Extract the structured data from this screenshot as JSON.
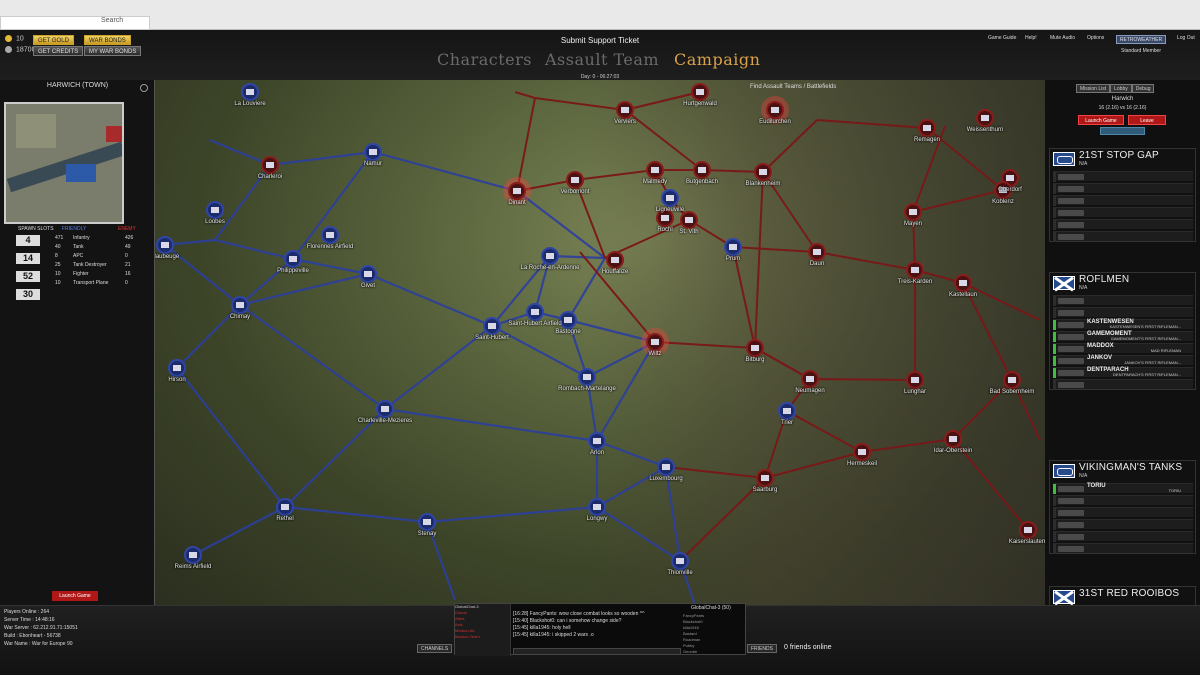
{
  "browser": {
    "search_label": "Search"
  },
  "top": {
    "gold": "10",
    "credits": "18700",
    "get_gold": "Get Gold",
    "war_bonds": "War Bonds",
    "get_credits": "Get Credits",
    "my_war_bonds": "My War Bonds",
    "support": "Submit Support Ticket",
    "tabs": [
      "Characters",
      "Assault Team",
      "Campaign"
    ],
    "day_time": "Day: 0 - 06:27:03",
    "links": [
      "Game Guide",
      "Help!",
      "Mute Audio",
      "Options",
      "Log Out"
    ],
    "rank": "RETROWEATHER",
    "member": "Standard Member"
  },
  "left": {
    "title": "HARWICH (TOWN)",
    "spawn_title": "SPAWN SLOTS",
    "friendly": "FRIENDLY",
    "enemy": "ENEMY",
    "spawn_values": [
      "4",
      "14",
      "52",
      "30"
    ],
    "units": [
      {
        "f": "471",
        "name": "Infantry",
        "e": "426"
      },
      {
        "f": "40",
        "name": "Tank",
        "e": "49"
      },
      {
        "f": "8",
        "name": "APC",
        "e": "0"
      },
      {
        "f": "25",
        "name": "Tank Destroyer",
        "e": "21"
      },
      {
        "f": "10",
        "name": "Fighter",
        "e": "16"
      },
      {
        "f": "10",
        "name": "Transport Plane",
        "e": "0"
      }
    ],
    "launch": "Launch Game"
  },
  "map": {
    "breadcrumb": "Find Assault Teams / Battlefields",
    "nodes": [
      "La Louviere",
      "Charleroi",
      "Namur",
      "Dinant",
      "Verbomont",
      "Malmedy",
      "Butgenbach",
      "Ligneuville",
      "Rochl",
      "St. Vith",
      "Blankenheim",
      "Eudilurchen",
      "Hurtgenwald",
      "Verviers",
      "Remagen",
      "Weissenthurn",
      "Oberdorf",
      "Koblenz",
      "Mayen",
      "Daun",
      "Prum",
      "Loobes",
      "Florennes Airfield",
      "Philippeville",
      "Givet",
      "Chimay",
      "La Roche-en-Ardenne",
      "Houffalize",
      "Saint-Hubert Airfield",
      "Bastogne",
      "Saint-Hubert",
      "Wiltz",
      "Bitburg",
      "Treis-Karden",
      "Kastellaun",
      "Neumagen",
      "Lunghar",
      "Bad Sobernheim",
      "Hirson",
      "Rombach-Martelange",
      "Charleville-Mezieres",
      "Arlon",
      "Trier",
      "Hermeskeil",
      "Idar-Oberstein",
      "Luxembourg",
      "Saarburg",
      "Rethel",
      "Longwy",
      "Stenay",
      "Thionville",
      "Reims Airfield",
      "Kaiserslautern",
      "Maubeuge"
    ]
  },
  "right": {
    "tabs": [
      "Mission List",
      "Lobby",
      "Debug"
    ],
    "map_name": "Harwich",
    "vs": "16 (2.16) vs 16 (2.16)",
    "launch": "Launch Game",
    "leave": "Leave",
    "teams": [
      {
        "name": "21ST STOP GAP",
        "sub": "N/A",
        "players": []
      },
      {
        "name": "ROFLMEN",
        "sub": "N/A",
        "players": [
          {
            "name": "KASTENWESEN",
            "cls": "KASTENWESEN'S FIRST RIFLEMAN..."
          },
          {
            "name": "GAMEMOMENT",
            "cls": "GAMEMOMENT'S FIRST RIFLEMAN..."
          },
          {
            "name": "MADDOX",
            "cls": "MAD RIFLEMAN"
          },
          {
            "name": "JANKOV",
            "cls": "JANKOV'S FIRST RIFLEMAN..."
          },
          {
            "name": "DENTPARACH",
            "cls": "DENTPARACH'S FIRST RIFLEMAN..."
          }
        ]
      },
      {
        "name": "VIKINGMAN'S TANKS",
        "sub": "N/A",
        "players": [
          {
            "name": "TORIU",
            "cls": "TORIU"
          }
        ]
      },
      {
        "name": "31ST RED ROOIBOS",
        "sub": "",
        "players": []
      }
    ]
  },
  "bottom": {
    "server": [
      "Players Online : 264",
      "Server Time : 14:48:16",
      "War Server : 62.212.91.71:15051",
      "Build : Ebonheart - 56738",
      "War Name : War for Europe 90"
    ],
    "chat_title": "GlobalChat-3 (50)",
    "channel_tab": "GlobalChat-3",
    "chat_channels": [
      "Global",
      "Allies",
      "Axis",
      "Mission-All",
      "Mission-Team"
    ],
    "chat": [
      "[16:28] FancyPants: wow close combat looks so wooden ^^",
      "[15:40] Blackshot0: can i somehow change side?",
      "[15:45] killa1945: holy hell",
      "[15:45] killa1945: i skipped 2 wars .o"
    ],
    "chat_users": [
      "FancyPants",
      "Blackshot0",
      "killa1945",
      "Bastard",
      "Roadman",
      "Pubby",
      "Geordie"
    ],
    "channels_btn": "CHANNELS",
    "friends_btn": "FRIENDS",
    "friends_online": "0 friends online"
  },
  "colors": {
    "allied": "#2f46a8",
    "axis": "#8a1c1c",
    "accent": "#d9a04a",
    "launch": "#b01818"
  }
}
